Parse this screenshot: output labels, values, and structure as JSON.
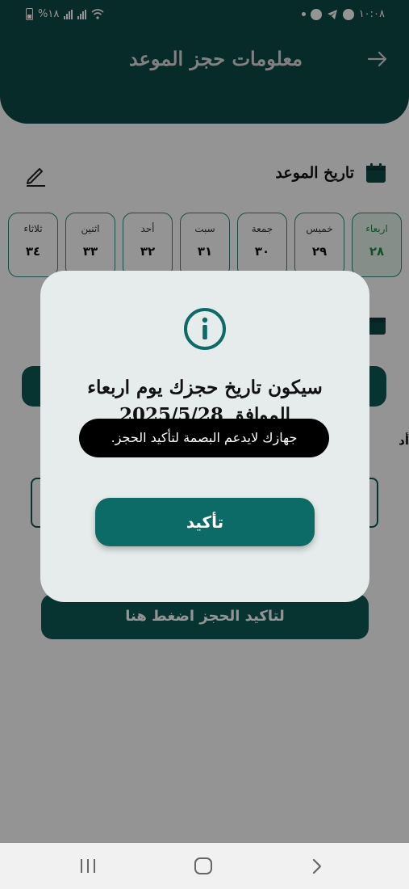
{
  "status_bar": {
    "battery_text": "%١٨",
    "time": "١٠:٠٨"
  },
  "header": {
    "title": "معلومات حجز الموعد"
  },
  "date_section": {
    "title": "تاريخ الموعد"
  },
  "days": [
    {
      "name": "اربعاء",
      "number": "٢٨",
      "selected": true
    },
    {
      "name": "خميس",
      "number": "٢٩",
      "selected": false
    },
    {
      "name": "جمعة",
      "number": "٣٠",
      "selected": false
    },
    {
      "name": "سبت",
      "number": "٣١",
      "selected": false
    },
    {
      "name": "أحد",
      "number": "٣٢",
      "selected": false
    },
    {
      "name": "اثنين",
      "number": "٣٣",
      "selected": false
    },
    {
      "name": "ثلاثاء",
      "number": "٣٤",
      "selected": false
    }
  ],
  "form": {
    "partial_label": "أد"
  },
  "confirm_booking_button": "لتاكيد الحجز اضغط هنا",
  "dialog": {
    "message": "سيكون تاريخ حجزك يوم اربعاء الموافق 2025/5/28",
    "confirm_label": "تأكيد"
  },
  "toast": "جهازك لايدعم البصمة لتأكيد الحجز.",
  "colors": {
    "primary": "#0d4a46",
    "accent": "#0d6b67",
    "selected_day": "#1f8a4c",
    "dialog_bg": "#e6eceb"
  },
  "icons": [
    "battery-icon",
    "signal-icon",
    "wifi-icon",
    "messenger-icon",
    "telegram-icon",
    "whatsapp-icon",
    "back-arrow-icon",
    "calendar-icon",
    "edit-icon",
    "info-icon"
  ]
}
